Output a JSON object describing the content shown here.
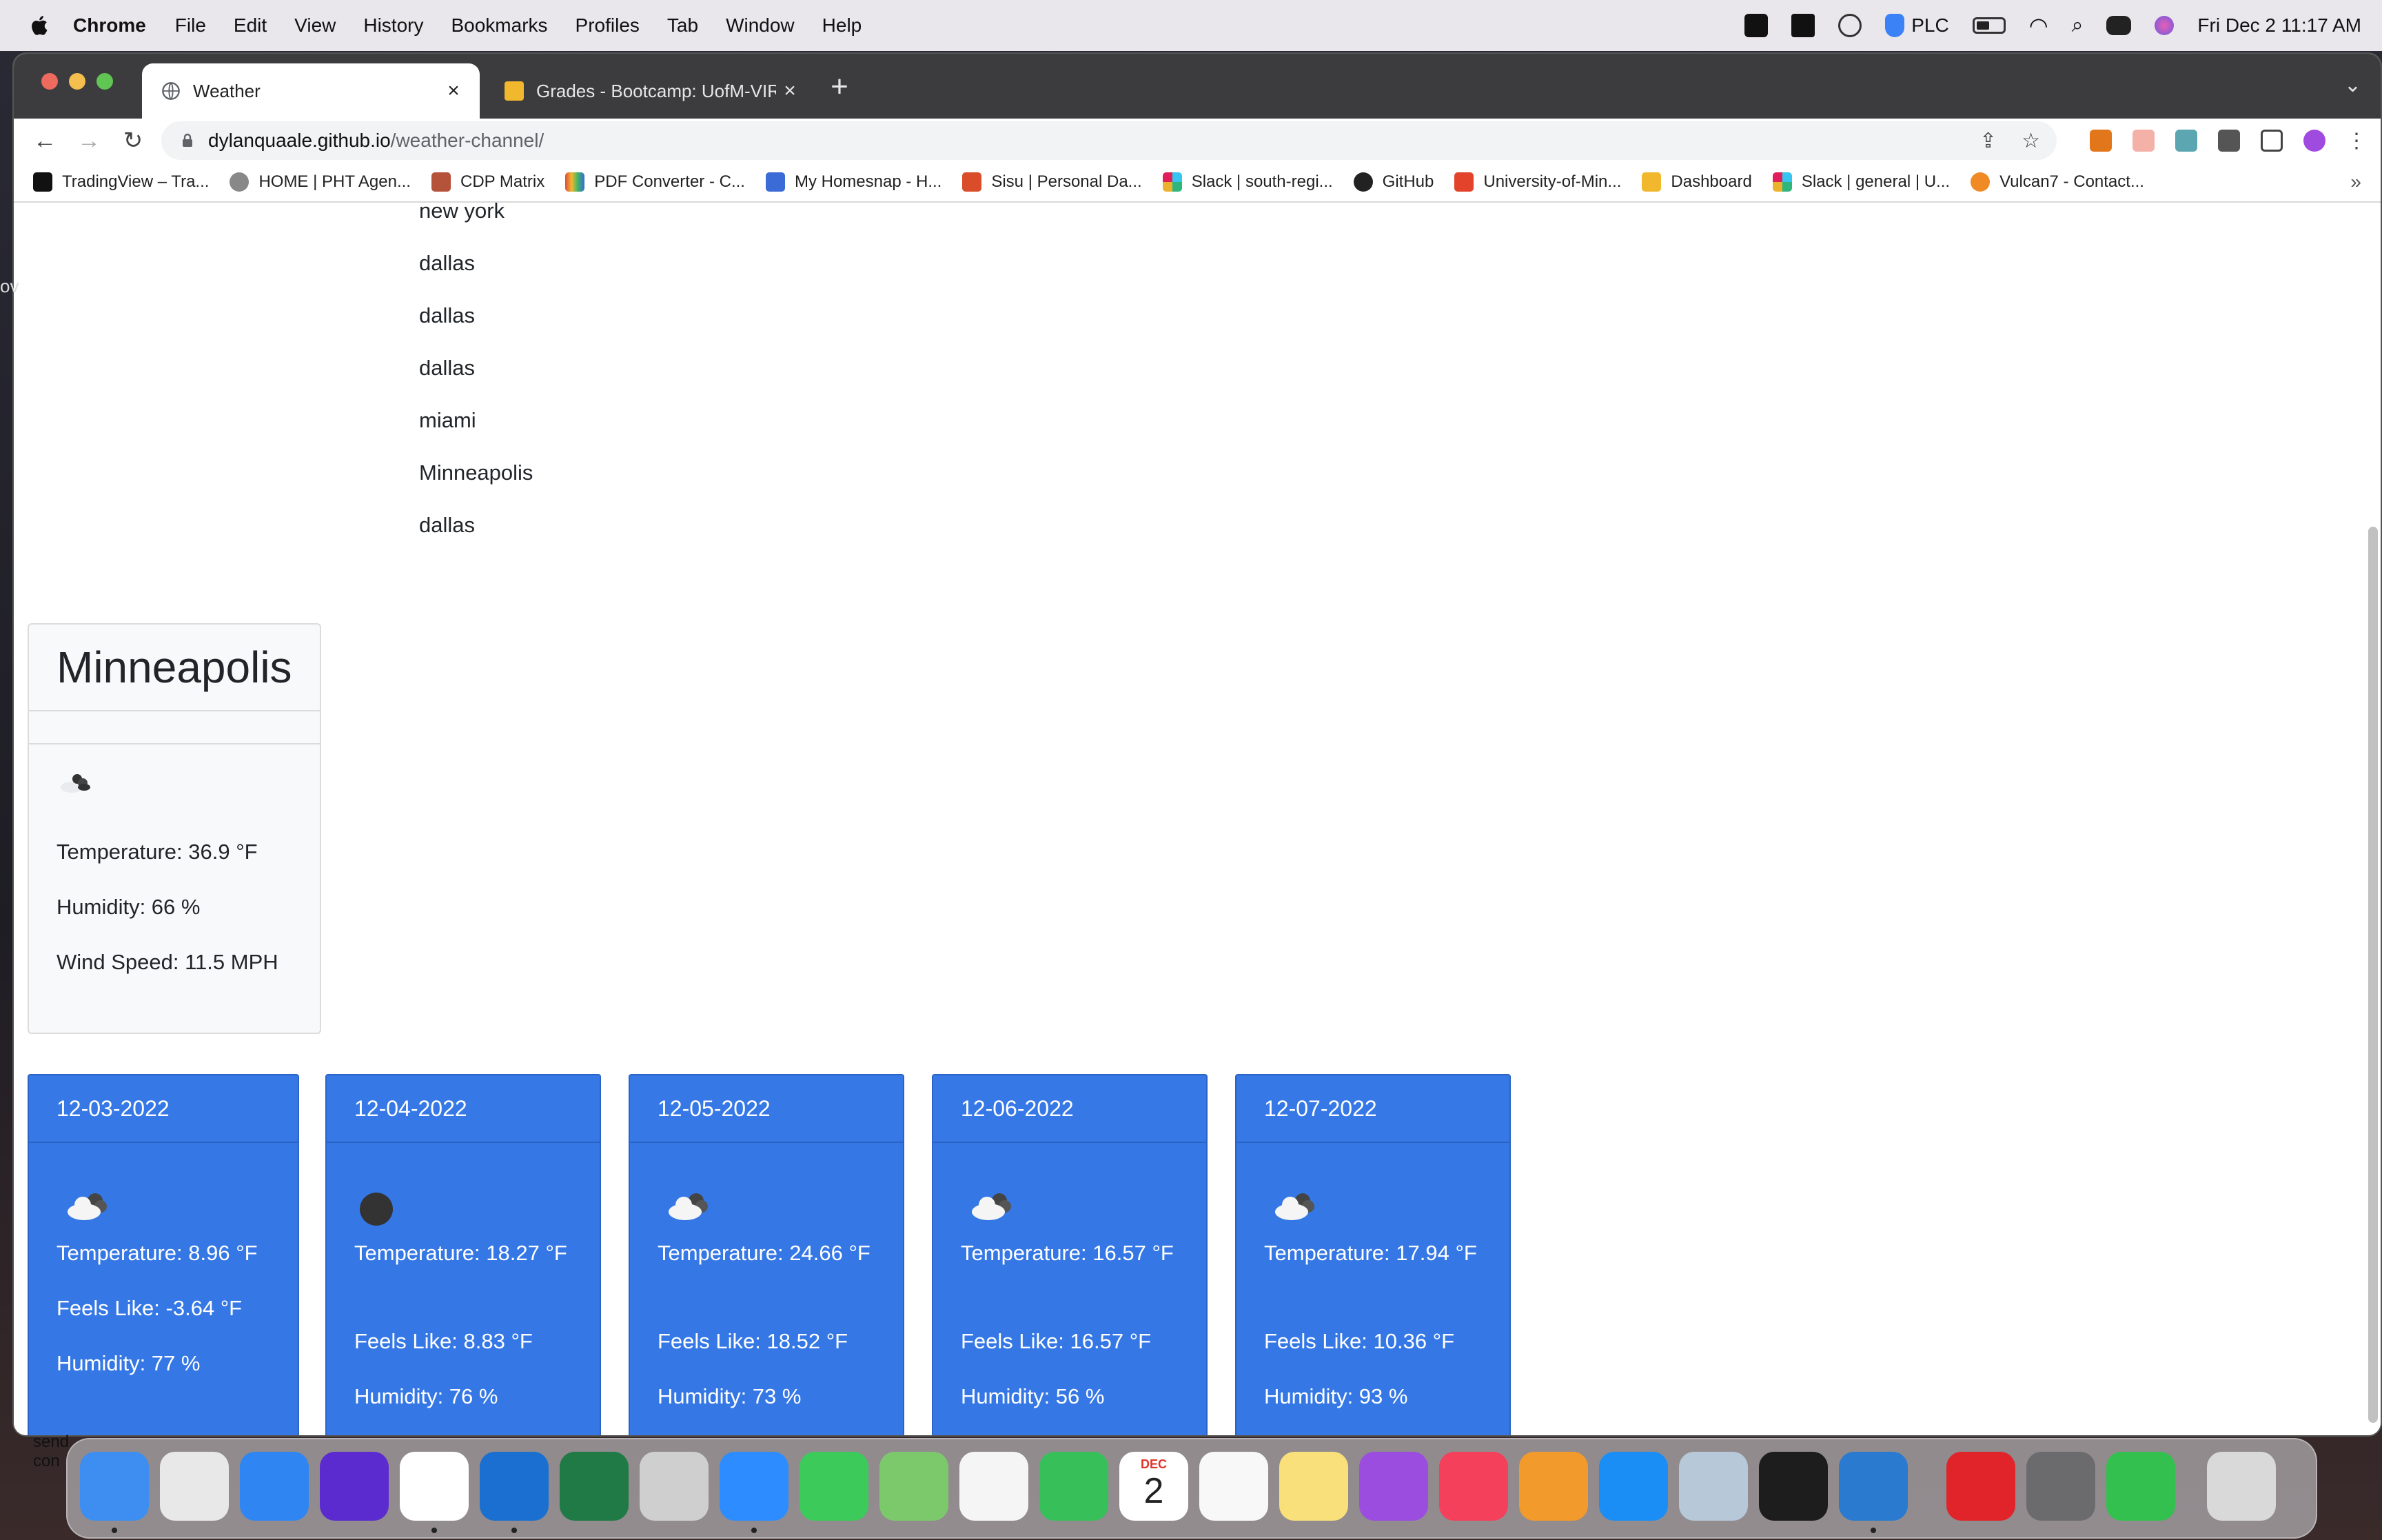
{
  "menubar": {
    "app": "Chrome",
    "items": [
      "File",
      "Edit",
      "View",
      "History",
      "Bookmarks",
      "Profiles",
      "Tab",
      "Window",
      "Help"
    ],
    "status_text": "PLC",
    "datetime": "Fri Dec 2  11:17 AM"
  },
  "tabs": [
    {
      "title": "Weather",
      "close": "×"
    },
    {
      "title": "Grades - Bootcamp: UofM-VIR",
      "close": "×"
    }
  ],
  "toolbar": {
    "url_host": "dylanquaale.github.io",
    "url_path": "/weather-channel/"
  },
  "bookmarks": [
    {
      "label": "TradingView – Tra...",
      "color": "#111111"
    },
    {
      "label": "HOME | PHT Agen...",
      "color": "#888888"
    },
    {
      "label": "CDP Matrix",
      "color": "#b5523a"
    },
    {
      "label": "PDF Converter - C...",
      "color": "#e24a3b"
    },
    {
      "label": "My Homesnap - H...",
      "color": "#3b6bd6"
    },
    {
      "label": "Sisu | Personal Da...",
      "color": "#d94d2a"
    },
    {
      "label": "Slack | south-regi...",
      "color": "#4a154b"
    },
    {
      "label": "GitHub",
      "color": "#222222"
    },
    {
      "label": "University-of-Min...",
      "color": "#e2432a"
    },
    {
      "label": "Dashboard",
      "color": "#f1b82d"
    },
    {
      "label": "Slack | general | U...",
      "color": "#36c5f0"
    },
    {
      "label": "Vulcan7 - Contact...",
      "color": "#f08a24"
    }
  ],
  "bookmarks_more": "»",
  "search_history": [
    "new york",
    "dallas",
    "dallas",
    "dallas",
    "miami",
    "Minneapolis",
    "dallas"
  ],
  "current": {
    "city": "Minneapolis",
    "temperature": "Temperature: 36.9 °F",
    "humidity": "Humidity: 66 %",
    "wind": "Wind Speed: 11.5 MPH",
    "icon": "broken-clouds-icon"
  },
  "forecast": [
    {
      "date": "12-03-2022",
      "icon": "cloud-icon",
      "temp": "Temperature: 8.96 °F",
      "feels": "Feels Like: -3.64 °F",
      "humidity": "Humidity: 77 %"
    },
    {
      "date": "12-04-2022",
      "icon": "overcast-icon",
      "temp": "Temperature: 18.27 °F",
      "feels": "Feels Like: 8.83 °F",
      "humidity": "Humidity: 76 %"
    },
    {
      "date": "12-05-2022",
      "icon": "cloud-icon",
      "temp": "Temperature: 24.66 °F",
      "feels": "Feels Like: 18.52 °F",
      "humidity": "Humidity: 73 %"
    },
    {
      "date": "12-06-2022",
      "icon": "cloud-icon",
      "temp": "Temperature: 16.57 °F",
      "feels": "Feels Like: 16.57 °F",
      "humidity": "Humidity: 56 %"
    },
    {
      "date": "12-07-2022",
      "icon": "cloud-icon",
      "temp": "Temperature: 17.94 °F",
      "feels": "Feels Like: 10.36 °F",
      "humidity": "Humidity: 93 %"
    }
  ],
  "dock": {
    "calendar_month": "DEC",
    "calendar_day": "2",
    "apps": [
      {
        "name": "finder",
        "color": "#3d8ef0"
      },
      {
        "name": "launchpad",
        "color": "#e8e8e8"
      },
      {
        "name": "safari",
        "color": "#2f86f3"
      },
      {
        "name": "firefox",
        "color": "#5b2bd0"
      },
      {
        "name": "chrome",
        "color": "#ffffff"
      },
      {
        "name": "outlook",
        "color": "#1a6fd0"
      },
      {
        "name": "excel",
        "color": "#1f7a45"
      },
      {
        "name": "unknown",
        "color": "#cfcfcf"
      },
      {
        "name": "zoom",
        "color": "#2d8cff"
      },
      {
        "name": "messages",
        "color": "#3ccb5a"
      },
      {
        "name": "maps",
        "color": "#7cc96b"
      },
      {
        "name": "photos",
        "color": "#f5f5f5"
      },
      {
        "name": "facetime",
        "color": "#37c05a"
      },
      {
        "name": "calendar",
        "color": "#ffffff"
      },
      {
        "name": "reminders",
        "color": "#f8f8f8"
      },
      {
        "name": "notes",
        "color": "#f9e07a"
      },
      {
        "name": "podcasts",
        "color": "#9b4de0"
      },
      {
        "name": "music",
        "color": "#f4405a"
      },
      {
        "name": "pages",
        "color": "#f39a2c"
      },
      {
        "name": "app-store",
        "color": "#1b8ef5"
      },
      {
        "name": "preview",
        "color": "#b7c9d8"
      },
      {
        "name": "terminal",
        "color": "#1d1d1d"
      },
      {
        "name": "vscode",
        "color": "#2a7ad0"
      },
      {
        "name": "bitdefender",
        "color": "#e0242a"
      },
      {
        "name": "system-preferences",
        "color": "#6b6b6e"
      },
      {
        "name": "numbers",
        "color": "#33c04f"
      },
      {
        "name": "trash",
        "color": "#d9d9d9"
      }
    ]
  },
  "leftover_text": [
    "send",
    "con"
  ],
  "edge_text": "ov",
  "colors": {
    "card_blue": "#3578e5",
    "menubar": "#e9e7ec",
    "tabstrip": "#3c3c3e"
  }
}
